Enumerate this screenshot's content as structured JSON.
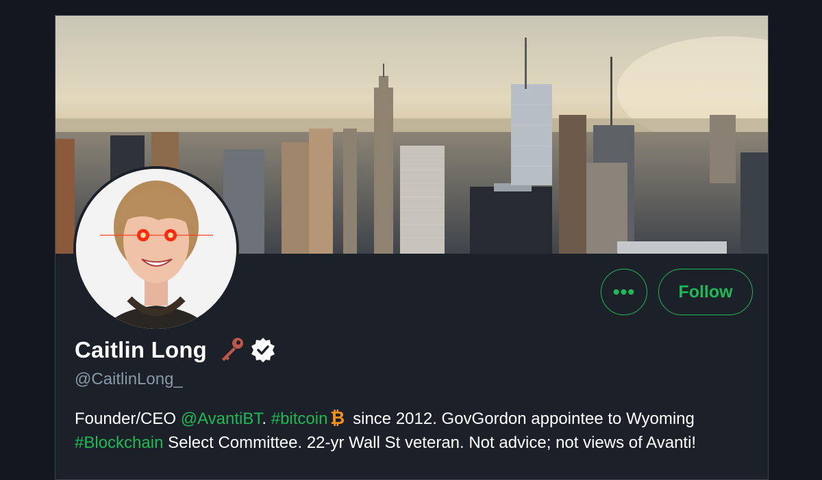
{
  "profile": {
    "name": "Caitlin Long",
    "handle": "@CaitlinLong_",
    "name_icons": [
      "key-icon",
      "verified-badge-icon"
    ]
  },
  "actions": {
    "more_label": "•••",
    "follow_label": "Follow"
  },
  "bio": {
    "part1": "Founder/CEO ",
    "mention": "@AvantiBT",
    "part2": ". ",
    "hashtag1": "#bitcoin",
    "bitcoin_icon": "bitcoin-icon",
    "part3": " since 2012. GovGordon appointee to Wyoming",
    "hashtag2": "#Blockchain",
    "part4": " Select Committee. 22-yr Wall St veteran. Not advice; not views of Avanti!"
  },
  "colors": {
    "accent": "#1db954",
    "background": "#1b2029",
    "secondary_text": "#8899a6"
  }
}
